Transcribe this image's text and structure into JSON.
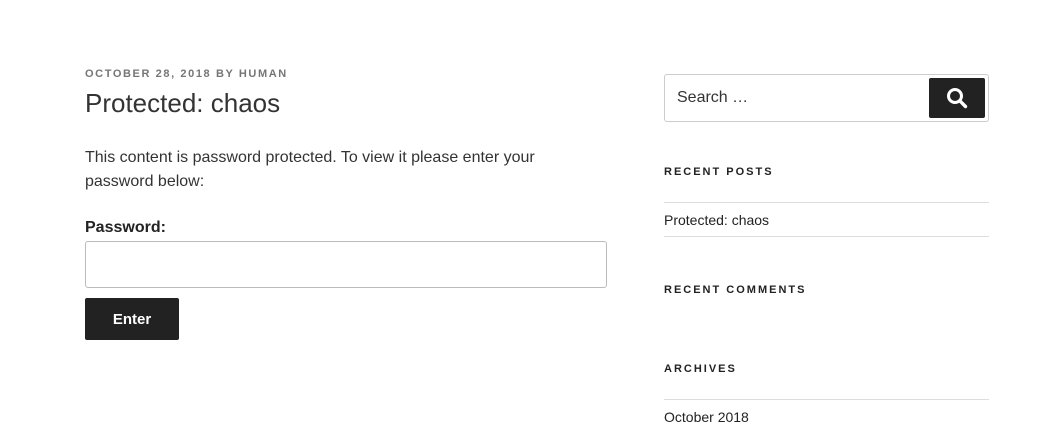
{
  "post": {
    "date": "OCTOBER 28, 2018",
    "by": "BY",
    "author": "HUMAN",
    "title": "Protected: chaos",
    "message": "This content is password protected. To view it please enter your password below:",
    "password_label": "Password:",
    "password_value": "",
    "enter_label": "Enter"
  },
  "sidebar": {
    "search": {
      "placeholder": "Search …",
      "button_icon": "search-icon"
    },
    "recent_posts": {
      "title": "RECENT POSTS",
      "items": [
        {
          "label": "Protected: chaos"
        }
      ]
    },
    "recent_comments": {
      "title": "RECENT COMMENTS"
    },
    "archives": {
      "title": "ARCHIVES",
      "items": [
        {
          "label": "October 2018"
        }
      ]
    }
  },
  "colors": {
    "button_bg": "#222222",
    "meta_text": "#767676",
    "body_text": "#333333"
  }
}
